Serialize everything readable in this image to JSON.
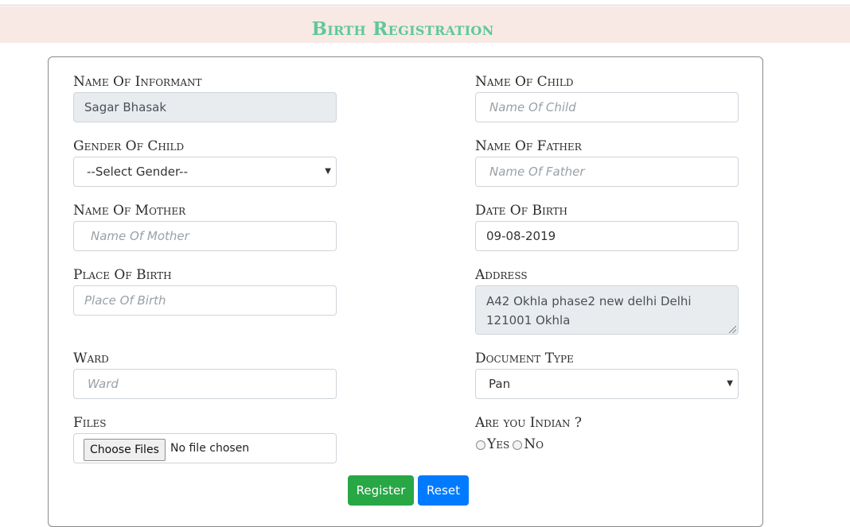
{
  "header": {
    "title": "Birth Registration"
  },
  "form": {
    "informant": {
      "label": "Name Of Informant",
      "value": "Sagar Bhasak"
    },
    "child": {
      "label": "Name Of Child",
      "placeholder": "Name Of Child"
    },
    "gender": {
      "label": "Gender Of Child",
      "selected": "--Select Gender--"
    },
    "father": {
      "label": "Name Of Father",
      "placeholder": "Name Of Father"
    },
    "mother": {
      "label": "Name Of Mother",
      "placeholder": "Name Of Mother"
    },
    "dob": {
      "label": "Date Of Birth",
      "value": "09-08-2019"
    },
    "place": {
      "label": "Place Of Birth",
      "placeholder": "Place Of Birth"
    },
    "address": {
      "label": "Address",
      "value": "A42 Okhla phase2 new delhi Delhi 121001 Okhla"
    },
    "ward": {
      "label": "Ward",
      "placeholder": "Ward"
    },
    "doctype": {
      "label": "Document Type",
      "selected": "Pan"
    },
    "files": {
      "label": "Files",
      "button": "Choose Files",
      "status": "No file chosen"
    },
    "indian": {
      "label": "Are you Indian ?",
      "yes": "Yes",
      "no": "No"
    }
  },
  "actions": {
    "register": "Register",
    "reset": "Reset"
  },
  "icons": {
    "select_caret": "caret-down-icon"
  },
  "colors": {
    "title": "#5fc89a",
    "header_bg": "#f8e9e5",
    "register": "#28a745",
    "reset": "#007bff"
  }
}
